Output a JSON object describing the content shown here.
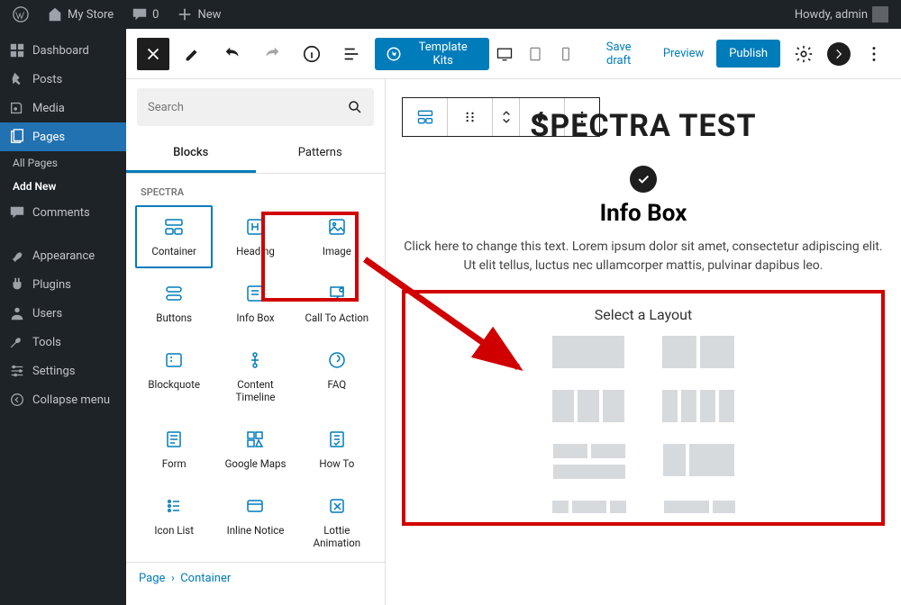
{
  "adminbar": {
    "site": "My Store",
    "comments": "0",
    "new": "New",
    "howdy": "Howdy, admin"
  },
  "sidenav": {
    "items": [
      {
        "label": "Dashboard",
        "icon": "dash"
      },
      {
        "label": "Posts",
        "icon": "pin"
      },
      {
        "label": "Media",
        "icon": "media"
      },
      {
        "label": "Pages",
        "icon": "pages",
        "active": true,
        "subs": [
          {
            "label": "All Pages"
          },
          {
            "label": "Add New",
            "bold": true
          }
        ]
      },
      {
        "label": "Comments",
        "icon": "comment"
      },
      {
        "label": "Appearance",
        "icon": "brush"
      },
      {
        "label": "Plugins",
        "icon": "plug"
      },
      {
        "label": "Users",
        "icon": "user"
      },
      {
        "label": "Tools",
        "icon": "wrench"
      },
      {
        "label": "Settings",
        "icon": "sliders"
      },
      {
        "label": "Collapse menu",
        "icon": "collapse"
      }
    ]
  },
  "editor_top": {
    "template_kits": "Template Kits",
    "save_draft": "Save draft",
    "preview": "Preview",
    "publish": "Publish"
  },
  "inserter": {
    "search_placeholder": "Search",
    "tab_blocks": "Blocks",
    "tab_patterns": "Patterns",
    "category": "SPECTRA",
    "blocks": [
      {
        "label": "Container"
      },
      {
        "label": "Heading"
      },
      {
        "label": "Image"
      },
      {
        "label": "Buttons"
      },
      {
        "label": "Info Box"
      },
      {
        "label": "Call To Action"
      },
      {
        "label": "Blockquote"
      },
      {
        "label": "Content Timeline"
      },
      {
        "label": "FAQ"
      },
      {
        "label": "Form"
      },
      {
        "label": "Google Maps"
      },
      {
        "label": "How To"
      },
      {
        "label": "Icon List"
      },
      {
        "label": "Inline Notice"
      },
      {
        "label": "Lottie Animation"
      }
    ]
  },
  "canvas": {
    "page_title": "SPECTRA TEST",
    "infobox_title": "Info Box",
    "infobox_text": "Click here to change this text. Lorem ipsum dolor sit amet, consectetur adipiscing elit. Ut elit tellus, luctus nec ullamcorper mattis, pulvinar dapibus leo.",
    "layout_title": "Select a Layout"
  },
  "breadcrumb": {
    "a": "Page",
    "sep": "›",
    "b": "Container"
  }
}
